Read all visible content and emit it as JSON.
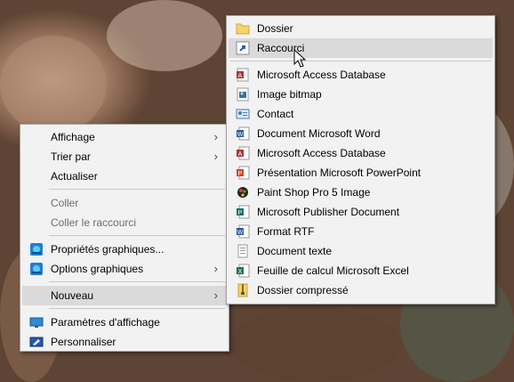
{
  "context_menu": {
    "items": [
      {
        "label": "Affichage"
      },
      {
        "label": "Trier par"
      },
      {
        "label": "Actualiser"
      },
      {
        "label": "Coller"
      },
      {
        "label": "Coller le raccourci"
      },
      {
        "label": "Propriétés graphiques..."
      },
      {
        "label": "Options graphiques"
      },
      {
        "label": "Nouveau"
      },
      {
        "label": "Paramètres d'affichage"
      },
      {
        "label": "Personnaliser"
      }
    ]
  },
  "submenu_nouveau": {
    "items": [
      {
        "label": "Dossier",
        "icon": "folder-icon"
      },
      {
        "label": "Raccourci",
        "icon": "shortcut-icon"
      },
      {
        "label": "Microsoft Access Database",
        "icon": "access-icon"
      },
      {
        "label": "Image bitmap",
        "icon": "bitmap-icon"
      },
      {
        "label": "Contact",
        "icon": "contact-icon"
      },
      {
        "label": "Document Microsoft Word",
        "icon": "word-icon"
      },
      {
        "label": "Microsoft Access Database",
        "icon": "access-icon"
      },
      {
        "label": "Présentation Microsoft PowerPoint",
        "icon": "powerpoint-icon"
      },
      {
        "label": "Paint Shop Pro 5 Image",
        "icon": "paintshop-icon"
      },
      {
        "label": "Microsoft Publisher Document",
        "icon": "publisher-icon"
      },
      {
        "label": "Format RTF",
        "icon": "rtf-icon"
      },
      {
        "label": "Document texte",
        "icon": "text-document-icon"
      },
      {
        "label": "Feuille de calcul Microsoft Excel",
        "icon": "excel-icon"
      },
      {
        "label": "Dossier compressé",
        "icon": "zip-folder-icon"
      }
    ]
  },
  "colors": {
    "menu_bg": "#f2f2f2",
    "hover_bg": "#dadada",
    "disabled_text": "#6d6d6d"
  }
}
